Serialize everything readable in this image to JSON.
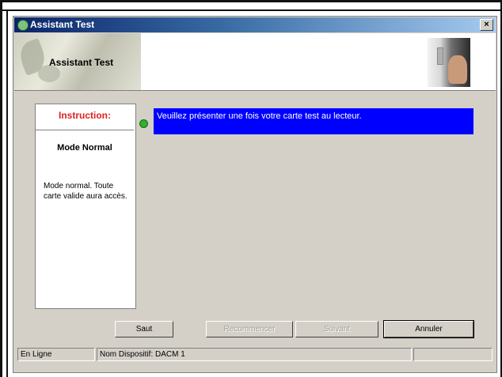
{
  "window": {
    "title": "Assistant Test",
    "close_label": "×"
  },
  "banner": {
    "title": "Assistant Test"
  },
  "left_panel": {
    "tab_label": "Instruction:",
    "mode_title": "Mode Normal",
    "mode_description": "Mode normal. Toute carte valide aura accès."
  },
  "message": {
    "text": "Veuillez présenter une fois votre carte test au lecteur.",
    "background_color": "#0000ff",
    "status_color": "#2fb02f"
  },
  "buttons": {
    "skip": "Saut",
    "retry": "Recommencer",
    "next": "Suivant",
    "cancel": "Annuler"
  },
  "statusbar": {
    "connection": "En Ligne",
    "device": "Nom Dispositif: DACM 1",
    "extra": ""
  }
}
